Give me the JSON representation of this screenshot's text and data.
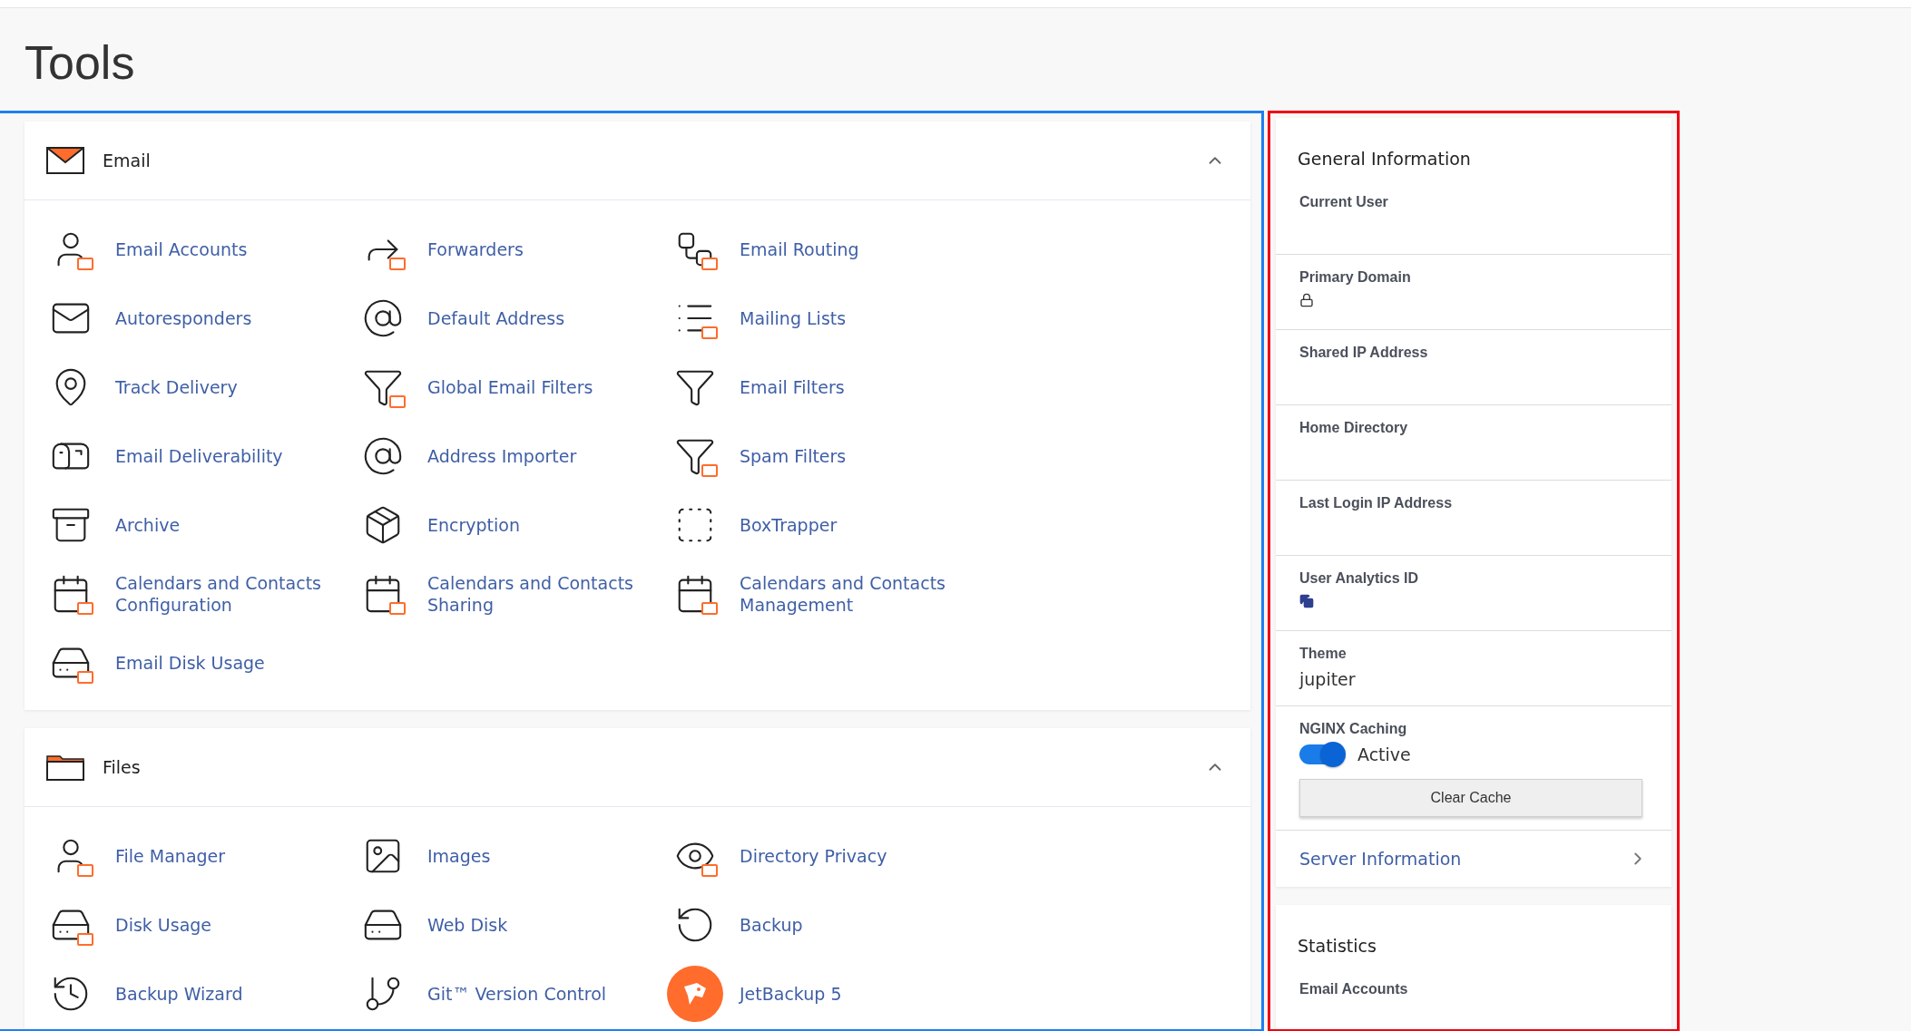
{
  "page": {
    "title": "Tools"
  },
  "sections": [
    {
      "title": "Email",
      "expanded": true,
      "items": [
        {
          "label": "Email Accounts"
        },
        {
          "label": "Forwarders"
        },
        {
          "label": "Email Routing"
        },
        {
          "label": "Autoresponders"
        },
        {
          "label": "Default Address"
        },
        {
          "label": "Mailing Lists"
        },
        {
          "label": "Track Delivery"
        },
        {
          "label": "Global Email Filters"
        },
        {
          "label": "Email Filters"
        },
        {
          "label": "Email Deliverability"
        },
        {
          "label": "Address Importer"
        },
        {
          "label": "Spam Filters"
        },
        {
          "label": "Archive"
        },
        {
          "label": "Encryption"
        },
        {
          "label": "BoxTrapper"
        },
        {
          "label": "Calendars and Contacts Configuration"
        },
        {
          "label": "Calendars and Contacts Sharing"
        },
        {
          "label": "Calendars and Contacts Management"
        },
        {
          "label": "Email Disk Usage"
        }
      ]
    },
    {
      "title": "Files",
      "expanded": true,
      "items": [
        {
          "label": "File Manager"
        },
        {
          "label": "Images"
        },
        {
          "label": "Directory Privacy"
        },
        {
          "label": "Disk Usage"
        },
        {
          "label": "Web Disk"
        },
        {
          "label": "Backup"
        },
        {
          "label": "Backup Wizard"
        },
        {
          "label": "Git™ Version Control"
        },
        {
          "label": "JetBackup 5"
        }
      ]
    }
  ],
  "general_information": {
    "title": "General Information",
    "rows": [
      {
        "kind": "text",
        "label": "Current User"
      },
      {
        "kind": "lock",
        "label": "Primary Domain"
      },
      {
        "kind": "text",
        "label": "Shared IP Address"
      },
      {
        "kind": "text",
        "label": "Home Directory"
      },
      {
        "kind": "text",
        "label": "Last Login IP Address"
      },
      {
        "kind": "copy",
        "label": "User Analytics ID"
      },
      {
        "kind": "text",
        "label": "Theme",
        "value": "jupiter"
      },
      {
        "kind": "toggle",
        "label": "NGINX Caching",
        "on": true,
        "status": "Active",
        "button": "Clear Cache"
      }
    ],
    "link": "Server Information"
  },
  "statistics": {
    "title": "Statistics",
    "rows": [
      {
        "label": "Email Accounts"
      }
    ]
  }
}
